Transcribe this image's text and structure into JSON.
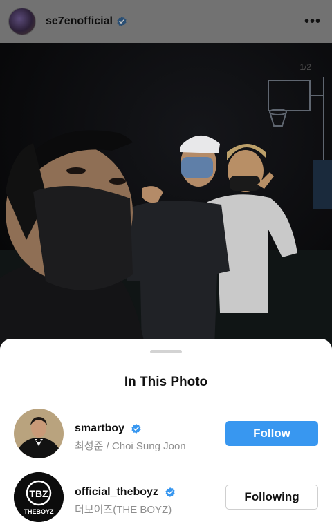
{
  "header": {
    "username": "se7enofficial",
    "verified": true,
    "more_icon": "more-horizontal-icon",
    "more_glyph": "•••"
  },
  "photo": {
    "counter": "1/2"
  },
  "sheet": {
    "title": "In This Photo",
    "people": [
      {
        "username": "smartboy",
        "verified": true,
        "subtitle": "최성준 / Choi Sung Joon",
        "button": "Follow",
        "button_state": "follow"
      },
      {
        "username": "official_theboyz",
        "verified": true,
        "subtitle": "더보이즈(THE BOYZ)",
        "button": "Following",
        "button_state": "following",
        "logo_text": "THEBOYZ",
        "logo_mark": "TBZ"
      }
    ]
  },
  "colors": {
    "accent": "#3897f0",
    "verified": "#3897f0"
  }
}
